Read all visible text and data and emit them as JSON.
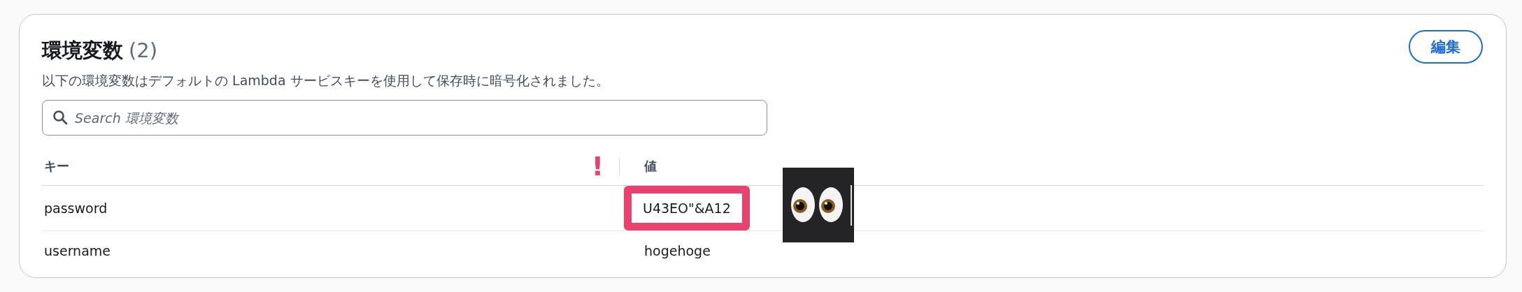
{
  "panel": {
    "title": "環境変数",
    "count": "(2)",
    "description": "以下の環境変数はデフォルトの Lambda サービスキーを使用して保存時に暗号化されました。",
    "edit_button": "編集"
  },
  "search": {
    "placeholder": "Search 環境変数"
  },
  "table": {
    "columns": [
      {
        "label": "キー",
        "alert_mark": "!"
      },
      {
        "label": "値"
      }
    ],
    "rows": [
      {
        "key": "password",
        "value": "U43EO\"&A12",
        "highlighted": true
      },
      {
        "key": "username",
        "value": "hogehoge",
        "highlighted": false
      }
    ]
  }
}
